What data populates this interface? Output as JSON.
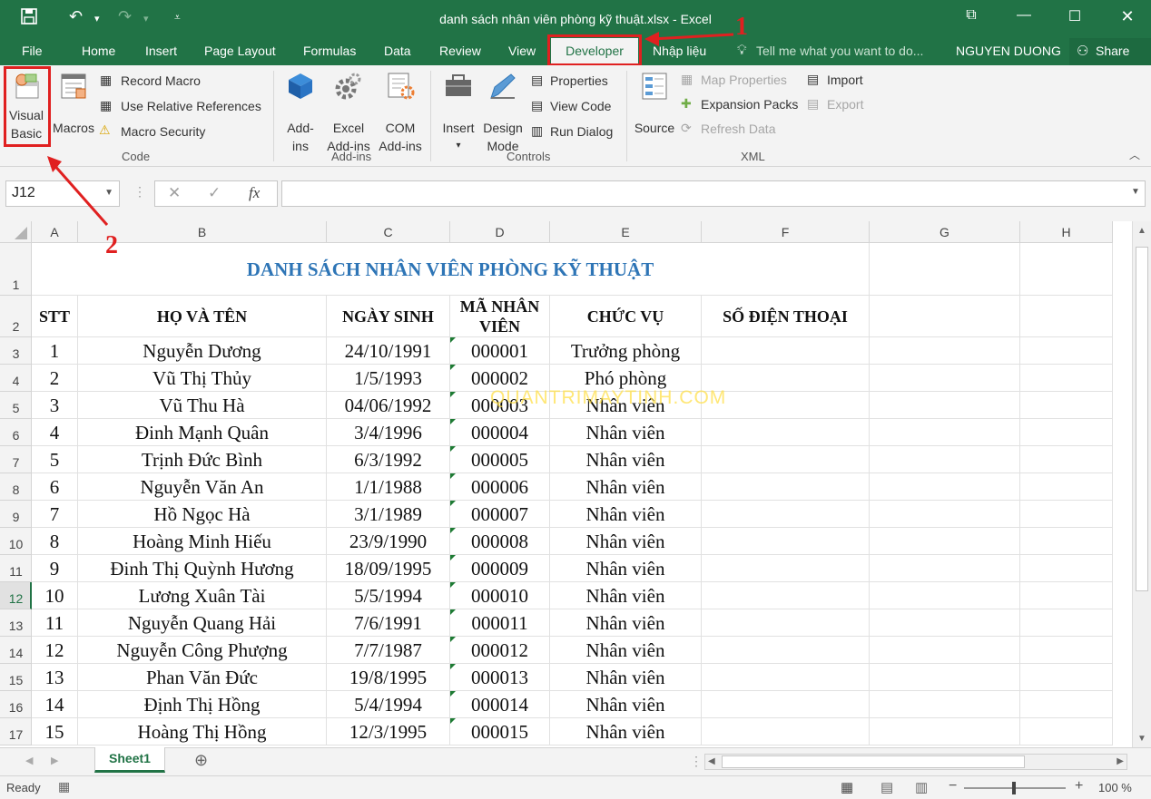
{
  "titlebar": {
    "title": "danh sách nhân viên phòng kỹ thuật.xlsx - Excel",
    "accent": "#217346"
  },
  "tabs": {
    "file": "File",
    "home": "Home",
    "insert": "Insert",
    "page_layout": "Page Layout",
    "formulas": "Formulas",
    "data": "Data",
    "review": "Review",
    "view": "View",
    "developer": "Developer",
    "nhap_lieu": "Nhập liệu",
    "tell_me": "Tell me what you want to do...",
    "user": "NGUYEN DUONG",
    "share": "Share"
  },
  "ribbon": {
    "code": {
      "label": "Code",
      "visual_basic_1": "Visual",
      "visual_basic_2": "Basic",
      "macros": "Macros",
      "record_macro": "Record Macro",
      "use_relative": "Use Relative References",
      "macro_security": "Macro Security"
    },
    "addins": {
      "label": "Add-ins",
      "addins_1": "Add-",
      "addins_2": "ins",
      "excel_1": "Excel",
      "excel_2": "Add-ins",
      "com_1": "COM",
      "com_2": "Add-ins"
    },
    "controls": {
      "label": "Controls",
      "insert": "Insert",
      "design_1": "Design",
      "design_2": "Mode",
      "properties": "Properties",
      "view_code": "View Code",
      "run_dialog": "Run Dialog"
    },
    "xml": {
      "label": "XML",
      "source": "Source",
      "map_properties": "Map Properties",
      "expansion_packs": "Expansion Packs",
      "refresh_data": "Refresh Data",
      "import": "Import",
      "export": "Export"
    }
  },
  "formula_bar": {
    "name_box": "J12",
    "fx": "fx",
    "value": ""
  },
  "columns": [
    "A",
    "B",
    "C",
    "D",
    "E",
    "F",
    "G",
    "H"
  ],
  "sheet": {
    "title": "DANH SÁCH NHÂN VIÊN PHÒNG KỸ THUẬT",
    "headers": [
      "STT",
      "HỌ VÀ TÊN",
      "NGÀY SINH",
      "MÃ NHÂN VIÊN",
      "CHỨC VỤ",
      "SỐ ĐIỆN THOẠI"
    ],
    "rows": [
      [
        "1",
        "Nguyễn Dương",
        "24/10/1991",
        "000001",
        "Trưởng phòng"
      ],
      [
        "2",
        "Vũ Thị Thủy",
        "1/5/1993",
        "000002",
        "Phó phòng"
      ],
      [
        "3",
        "Vũ Thu Hà",
        "04/06/1992",
        "000003",
        "Nhân viên"
      ],
      [
        "4",
        "Đinh Mạnh Quân",
        "3/4/1996",
        "000004",
        "Nhân viên"
      ],
      [
        "5",
        "Trịnh Đức Bình",
        "6/3/1992",
        "000005",
        "Nhân viên"
      ],
      [
        "6",
        "Nguyễn Văn An",
        "1/1/1988",
        "000006",
        "Nhân viên"
      ],
      [
        "7",
        "Hồ Ngọc Hà",
        "3/1/1989",
        "000007",
        "Nhân viên"
      ],
      [
        "8",
        "Hoàng Minh Hiếu",
        "23/9/1990",
        "000008",
        "Nhân viên"
      ],
      [
        "9",
        "Đinh Thị Quỳnh Hương",
        "18/09/1995",
        "000009",
        "Nhân viên"
      ],
      [
        "10",
        "Lương Xuân Tài",
        "5/5/1994",
        "000010",
        "Nhân viên"
      ],
      [
        "11",
        "Nguyễn Quang Hải",
        "7/6/1991",
        "000011",
        "Nhân viên"
      ],
      [
        "12",
        "Nguyễn Công Phượng",
        "7/7/1987",
        "000012",
        "Nhân viên"
      ],
      [
        "13",
        "Phan Văn Đức",
        "19/8/1995",
        "000013",
        "Nhân viên"
      ],
      [
        "14",
        "Định Thị Hồng",
        "5/4/1994",
        "000014",
        "Nhân viên"
      ],
      [
        "15",
        "Hoàng Thị Hồng",
        "12/3/1995",
        "000015",
        "Nhân viên"
      ]
    ],
    "row_numbers": [
      "1",
      "2",
      "3",
      "4",
      "5",
      "6",
      "7",
      "8",
      "9",
      "10",
      "11",
      "12",
      "13",
      "14",
      "15",
      "16",
      "17"
    ],
    "selected_row": "12",
    "title_color": "#2e75b6"
  },
  "watermark": "QUANTRIMAYTINH.COM",
  "sheet_tabs": {
    "active": "Sheet1"
  },
  "status": {
    "ready": "Ready",
    "zoom": "100 %"
  },
  "annotations": {
    "step1": "1",
    "step2": "2",
    "color": "#e02020"
  }
}
